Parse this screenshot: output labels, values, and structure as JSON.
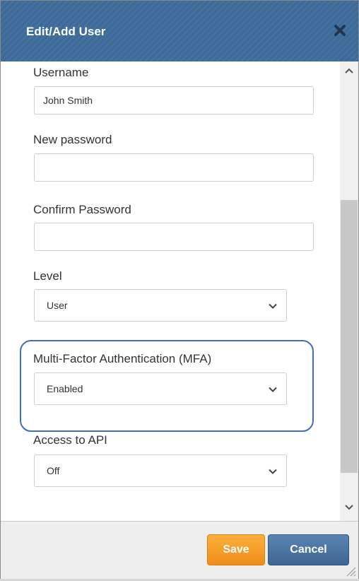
{
  "dialog": {
    "title": "Edit/Add User",
    "close_icon": "close-x-icon"
  },
  "form": {
    "username": {
      "label": "Username",
      "value": "John Smith"
    },
    "new_password": {
      "label": "New password",
      "value": ""
    },
    "confirm_password": {
      "label": "Confirm Password",
      "value": ""
    },
    "level": {
      "label": "Level",
      "value": "User"
    },
    "mfa": {
      "label": "Multi-Factor Authentication (MFA)",
      "value": "Enabled"
    },
    "api_access": {
      "label": "Access to API",
      "value": "Off"
    }
  },
  "footer": {
    "save_label": "Save",
    "cancel_label": "Cancel"
  },
  "colors": {
    "titlebar": "#3d6b99",
    "save_button": "#f5a02a",
    "cancel_button": "#4a72a0",
    "highlight": "#3f6fb7"
  }
}
